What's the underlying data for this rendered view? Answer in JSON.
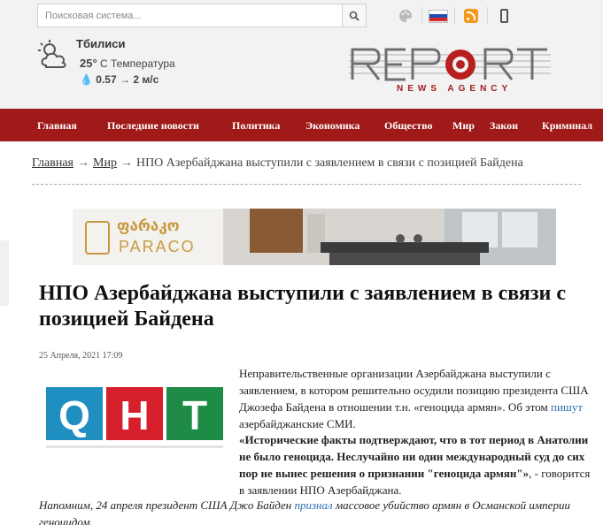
{
  "search": {
    "placeholder": "Поисковая система..."
  },
  "weather": {
    "city": "Тбилиси",
    "temp": "25°",
    "temp_suffix": "C Температура",
    "humidity": "0.57",
    "wind": "2 м/с"
  },
  "logo": {
    "agency_text": "NEWS AGENCY"
  },
  "nav": {
    "items": [
      "Главная",
      "Последние новости",
      "Политика",
      "Экономика",
      "Общество",
      "Мир",
      "Закон",
      "Криминал"
    ]
  },
  "breadcrumb": {
    "home": "Главная",
    "section": "Мир",
    "current": "НПО Азербайджана выступили с заявлением в связи с позицией Байдена"
  },
  "banner": {
    "geo_text": "ფარაკო",
    "brand": "PARACO"
  },
  "article": {
    "title": "НПО Азербайджана выступили с заявлением в связи с позицией Байдена",
    "date": "25 Апреля, 2021  17:09",
    "image_letters": [
      "Q",
      "H",
      "T"
    ],
    "p1_before": "Неправительственные организации Азербайджана выступили с заявлением, в котором решительно осудили позицию президента США Джозефа Байдена в отношении т.н. «геноцида армян». Об этом ",
    "p1_link": "пишут",
    "p1_after": " азербайджанские СМИ.",
    "quote_bold": "«Исторические факты подтверждают, что в тот период в Анатолии не было геноцида. Неслучайно ни один международный суд до сих пор не вынес решения о признании \"геноцида армян\"»",
    "quote_after": ", - говорится в заявлении НПО Азербайджана.",
    "note_before": "Напомним, 24 апреля президент США Джо Байден ",
    "note_link": "признал",
    "note_after": " массовое убийство армян в Османской империи геноцидом."
  },
  "colors": {
    "nav_bg": "#a01a1a",
    "link": "#2a6fb0",
    "gold": "#c79a3f"
  }
}
